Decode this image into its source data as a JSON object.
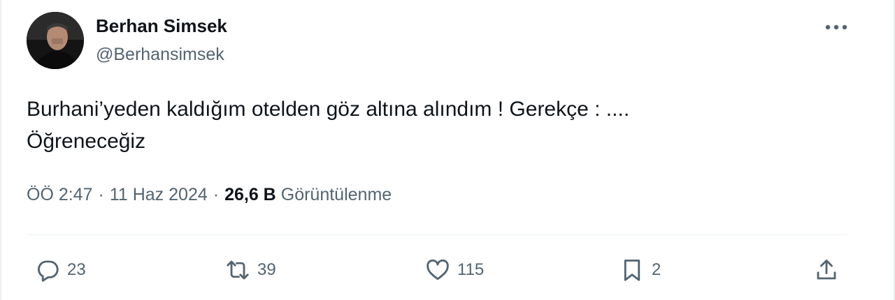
{
  "author": {
    "name": "Berhan Simsek",
    "handle": "@Berhansimsek"
  },
  "tweet": {
    "line1": "Burhani’yeden kaldığım otelden göz altına alındım ! Gerekçe : ....",
    "line2": "Öğreneceğiz"
  },
  "meta": {
    "time": "ÖÖ 2:47",
    "separator1": "·",
    "date": "11 Haz 2024",
    "separator2": "·",
    "views_count": "26,6 B",
    "views_label": "Görüntülenme"
  },
  "actions": {
    "reply_count": "23",
    "retweet_count": "39",
    "like_count": "115",
    "bookmark_count": "2"
  },
  "icons": {
    "more": "more-horizontal-icon",
    "reply": "reply-icon",
    "retweet": "retweet-icon",
    "like": "heart-icon",
    "bookmark": "bookmark-icon",
    "share": "share-icon"
  },
  "colors": {
    "text_primary": "#0f1419",
    "text_secondary": "#536471",
    "divider": "#eff3f4"
  }
}
